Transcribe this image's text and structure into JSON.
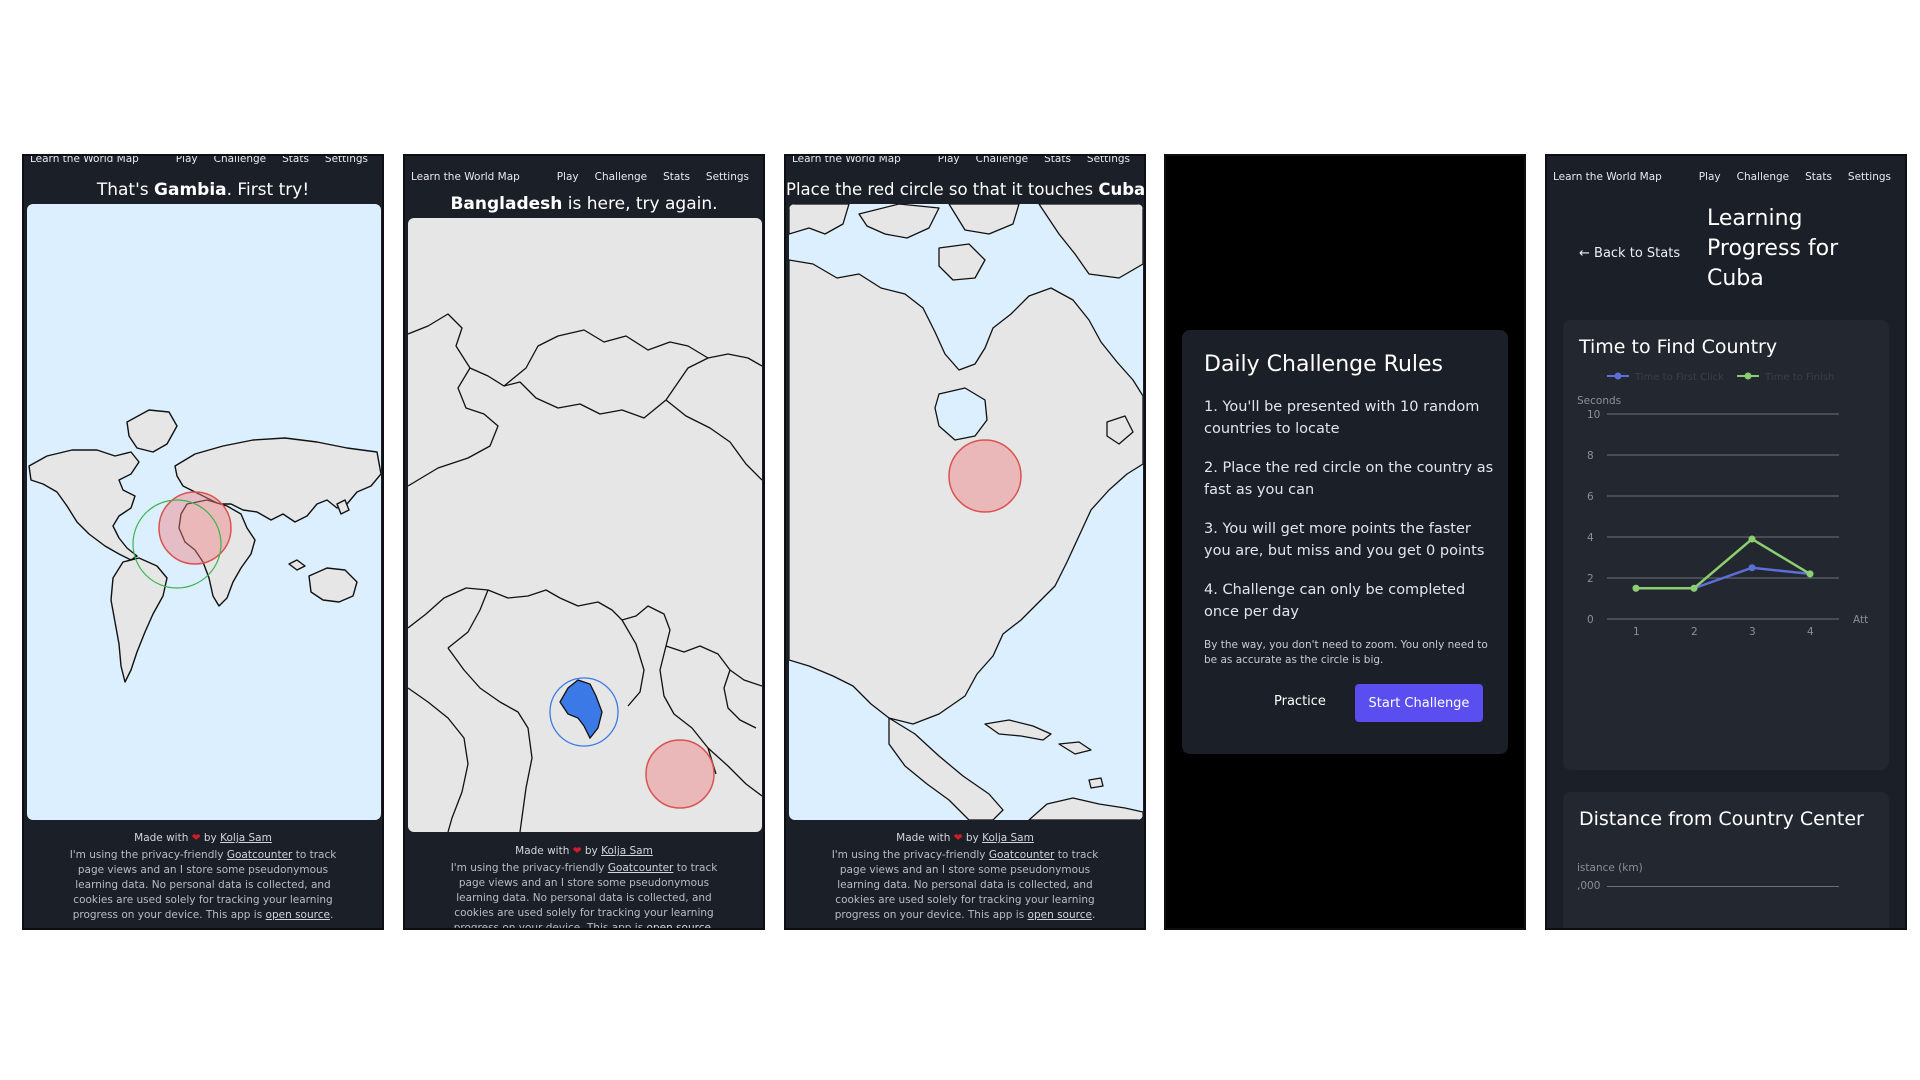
{
  "nav": {
    "brand": "Learn the World Map",
    "links": [
      "Play",
      "Challenge",
      "Stats",
      "Settings"
    ]
  },
  "footer": {
    "made_prefix": "Made with",
    "made_by": "by",
    "author": "Kolja Sam",
    "text1": "I'm using the privacy-friendly",
    "goatcounter": "Goatcounter",
    "text2": "to track page views and an I store some pseudonymous learning data. No personal data is collected, and cookies are used solely for tracking your learning progress on your device. This app is",
    "open_source": "open source",
    "end": "."
  },
  "screen1": {
    "pre": "That's ",
    "country": "Gambia",
    "post": ". First try!"
  },
  "screen2": {
    "country": "Bangladesh",
    "post": " is here, try again."
  },
  "screen3": {
    "pre": "Place the red circle so that it touches ",
    "country": "Cuba"
  },
  "modal": {
    "title": "Daily Challenge Rules",
    "rules": [
      "1. You'll be presented with 10 random countries to locate",
      "2. Place the red circle on the country as fast as you can",
      "3. You will get more points the faster you are, but miss and you get 0 points",
      "4. Challenge can only be completed once per day"
    ],
    "note": "By the way, you don't need to zoom. You only need to be as accurate as the circle is big.",
    "practice": "Practice",
    "start": "Start Challenge"
  },
  "stats": {
    "back": "← Back to Stats",
    "title": "Learning Progress for Cuba",
    "card1_title": "Time to Find Country",
    "card2_title": "Distance from Country Center",
    "card2_axis_label": "istance (km)",
    "card2_tick": ",000"
  },
  "chart_data": {
    "type": "line",
    "ylabel": "Seconds",
    "xlabel": "Att",
    "x": [
      1,
      2,
      3,
      4
    ],
    "ylim": [
      0,
      10
    ],
    "yticks": [
      0,
      2,
      4,
      6,
      8,
      10
    ],
    "grid": true,
    "legend": "top",
    "series": [
      {
        "name": "Time to First Click",
        "color": "#5b6fd6",
        "values": [
          1.5,
          1.5,
          2.5,
          2.2
        ]
      },
      {
        "name": "Time to Finish",
        "color": "#8bcf6f",
        "values": [
          1.5,
          1.5,
          3.9,
          2.2
        ]
      }
    ]
  },
  "colors": {
    "panel": "#1b1f27",
    "ocean": "#dcefff",
    "land": "#e6e6e6",
    "accent": "#5a4ef0",
    "wrong": "#f08080",
    "correct": "#39b54a",
    "highlight": "#3b7ae6"
  }
}
